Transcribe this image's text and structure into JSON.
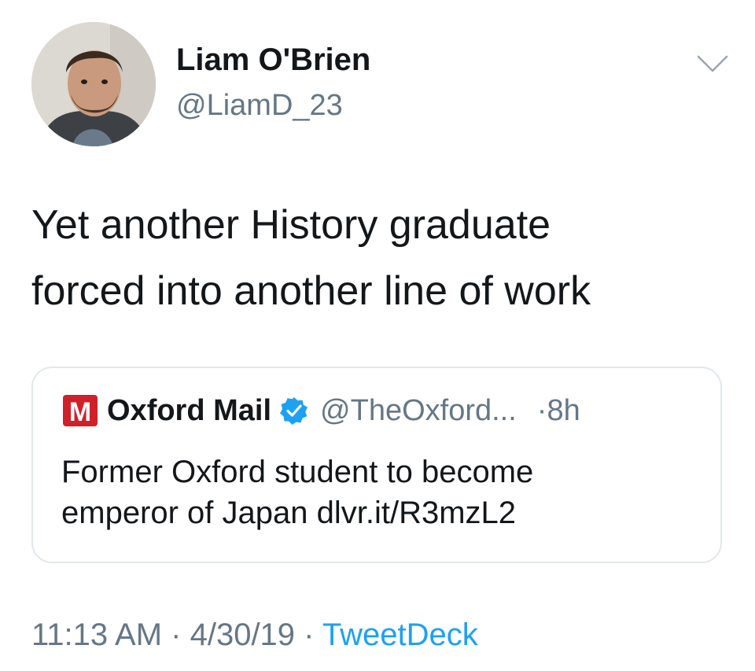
{
  "tweet": {
    "author": {
      "name": "Liam O'Brien",
      "handle": "@LiamD_23"
    },
    "text": "Yet another History graduate\nforced into another line of work",
    "menu_icon": "chevron-down-icon",
    "quoted": {
      "logo_letter": "M",
      "logo_icon": "oxford-mail-logo",
      "name": "Oxford Mail",
      "verified_icon": "verified-badge-icon",
      "handle": "@TheOxford...",
      "separator": "·",
      "time": "8h",
      "text": "Former Oxford student to become\nemperor of Japan dlvr.it/R3mzL2"
    },
    "meta": {
      "time": "11:13 AM",
      "sep1": " · ",
      "date": "4/30/19",
      "sep2": " · ",
      "source": "TweetDeck"
    }
  },
  "colors": {
    "text": "#14171a",
    "secondary": "#657786",
    "link": "#1da1f2",
    "border": "#e1e8ed",
    "verified": "#1da1f2",
    "logo_red": "#d0202a"
  }
}
